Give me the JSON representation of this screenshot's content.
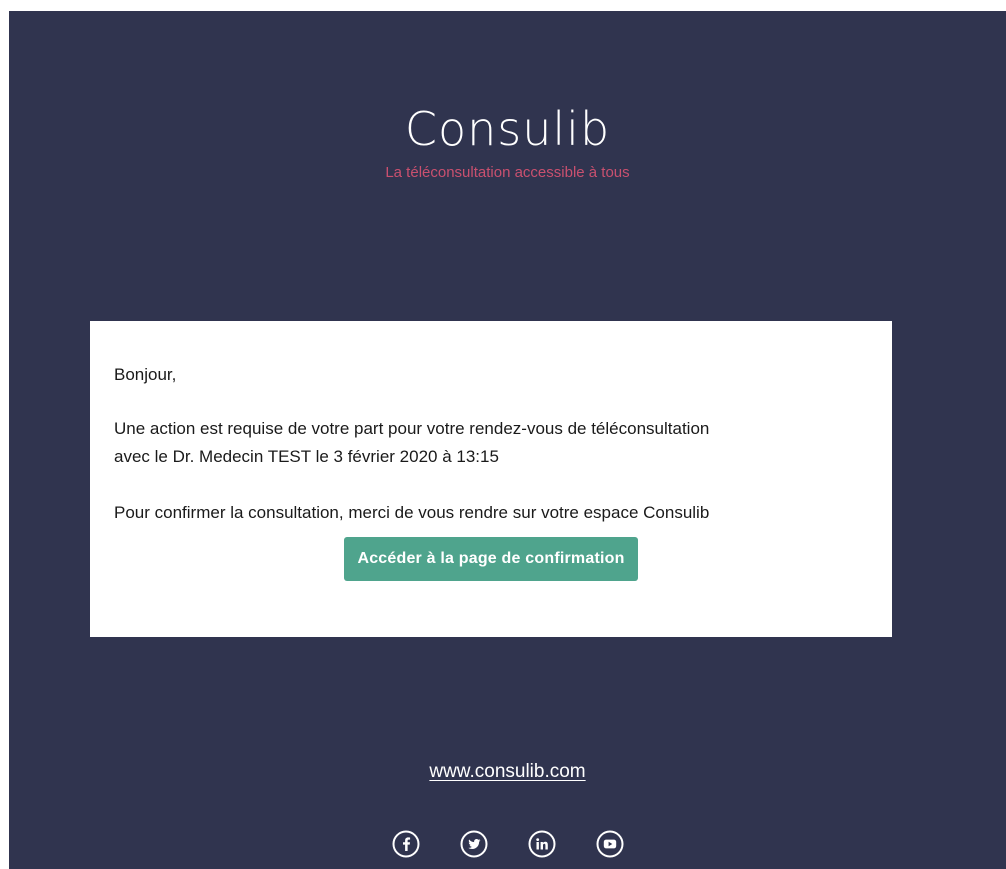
{
  "header": {
    "brand_name": "Consulib",
    "tagline": "La téléconsultation accessible à tous"
  },
  "message": {
    "greeting": "Bonjour,",
    "action_line_1": "Une action est requise de votre part pour votre rendez-vous de téléconsultation",
    "action_line_2": "avec le Dr. Medecin TEST le 3 février 2020 à 13:15",
    "instruction": "Pour confirmer la consultation, merci de vous rendre sur votre espace Consulib",
    "cta_label": "Accéder à la page de confirmation"
  },
  "footer": {
    "website": "www.consulib.com",
    "social_icons": [
      "facebook-icon",
      "twitter-icon",
      "linkedin-icon",
      "youtube-icon"
    ]
  },
  "colors": {
    "background": "#30344f",
    "tagline": "#c9506f",
    "button": "#4fa48d",
    "card": "#ffffff"
  }
}
